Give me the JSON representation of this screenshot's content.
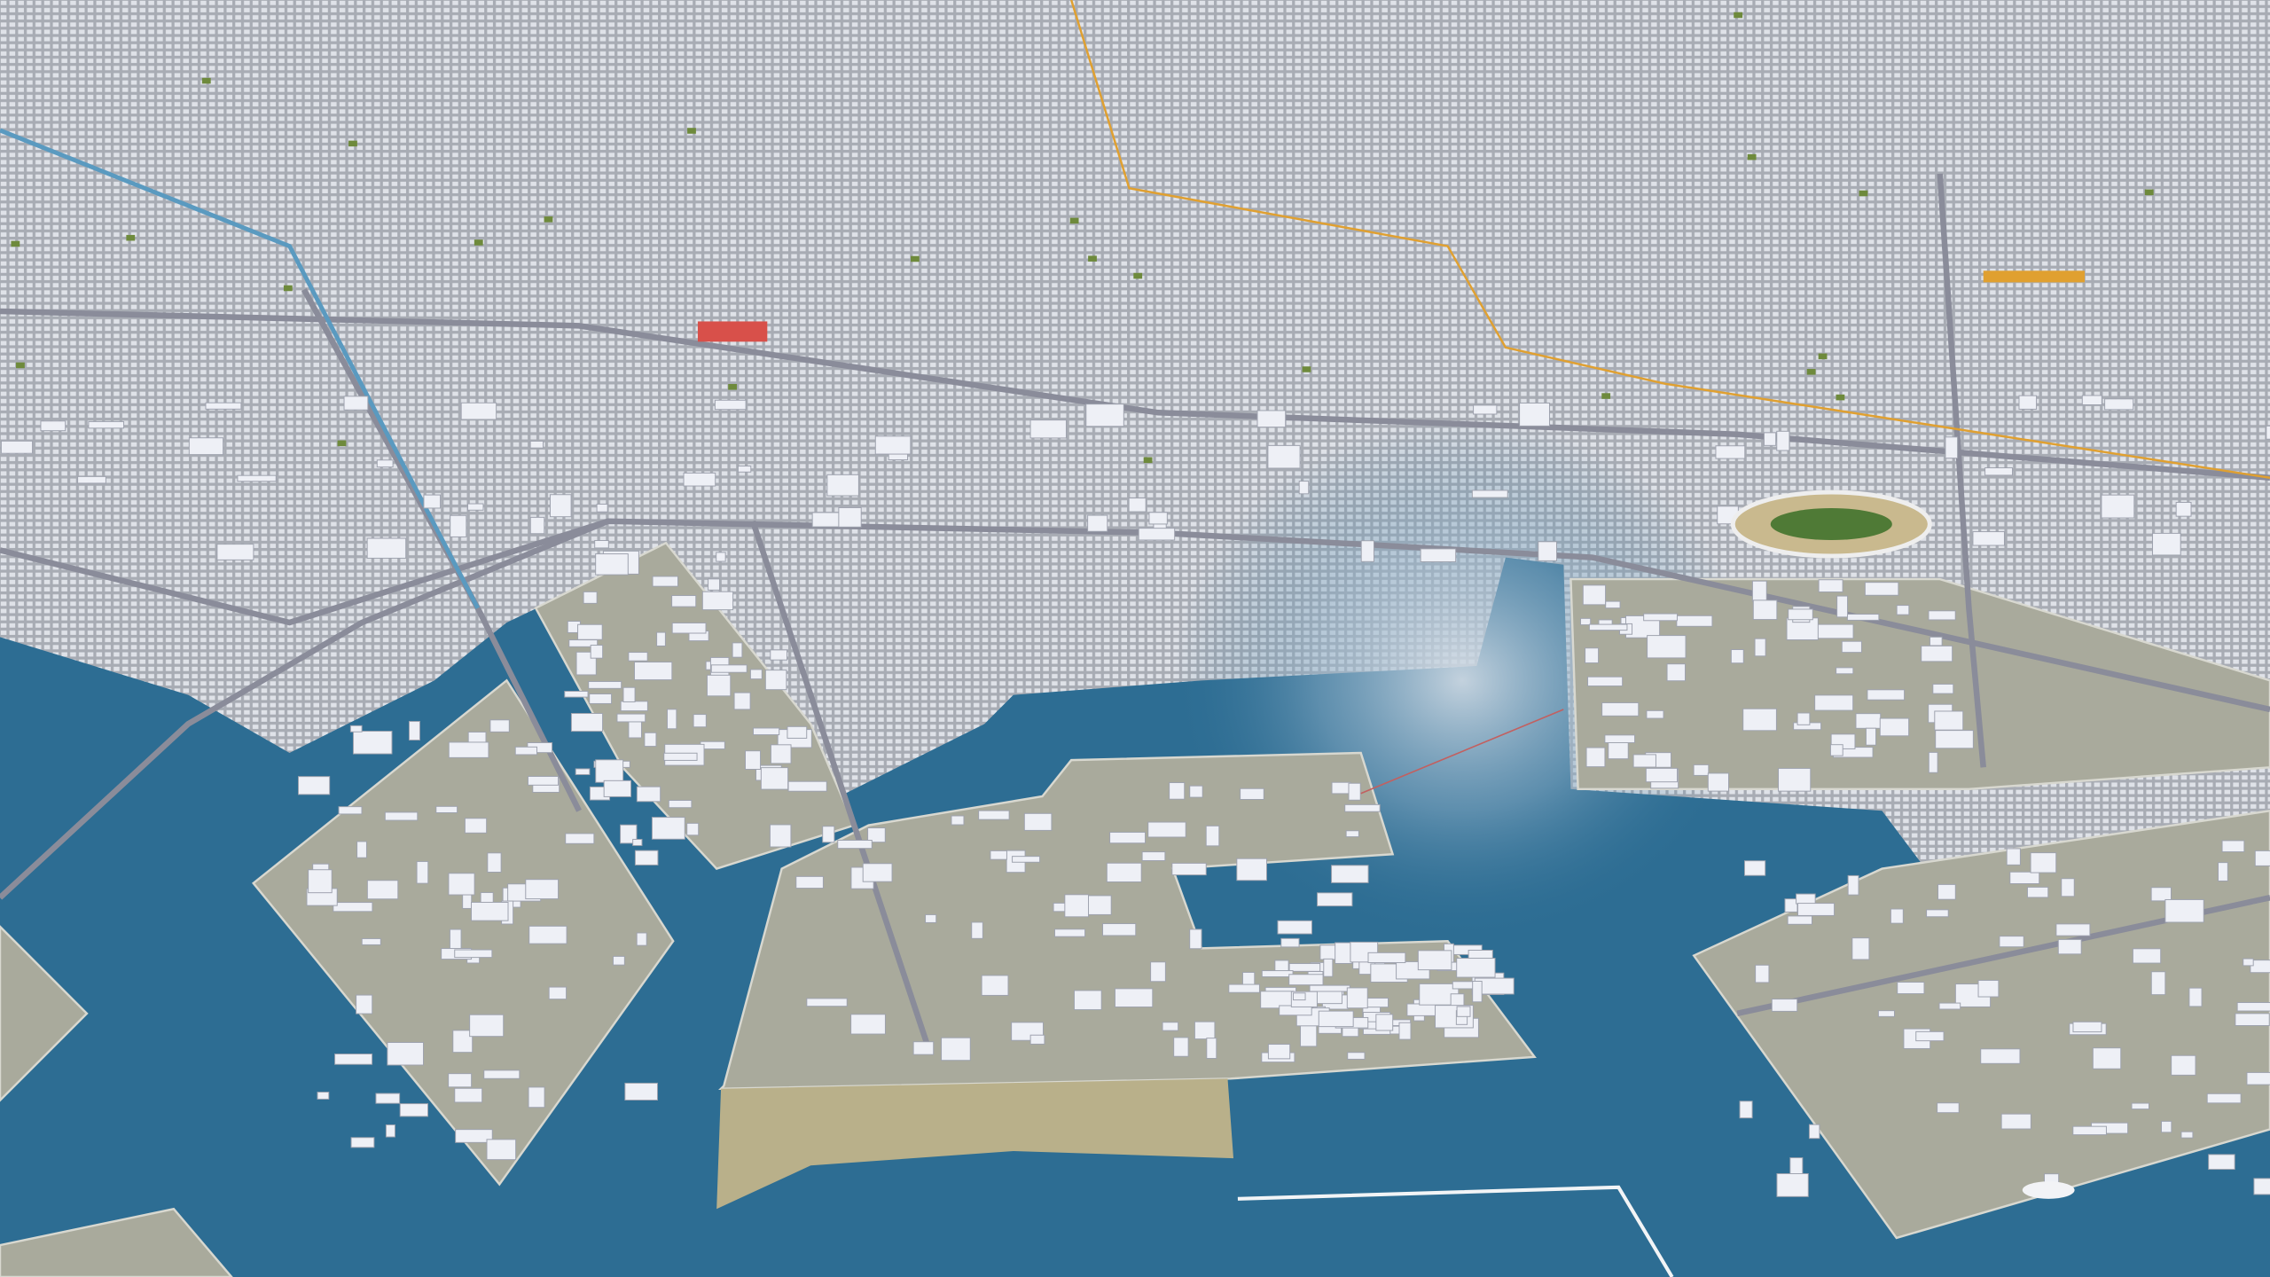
{
  "scene": {
    "colors": {
      "water": "#2d6d93",
      "water_glare": "#b9c9d6",
      "city": "#b4b8bf",
      "industrial": "#a9aa9c",
      "building": "#eef0f6",
      "sand": "#b9b08a",
      "road": "#8a8c9a",
      "rail": "#e0a030",
      "red_roof": "#d8504a",
      "green": "#6e8a3c"
    }
  }
}
